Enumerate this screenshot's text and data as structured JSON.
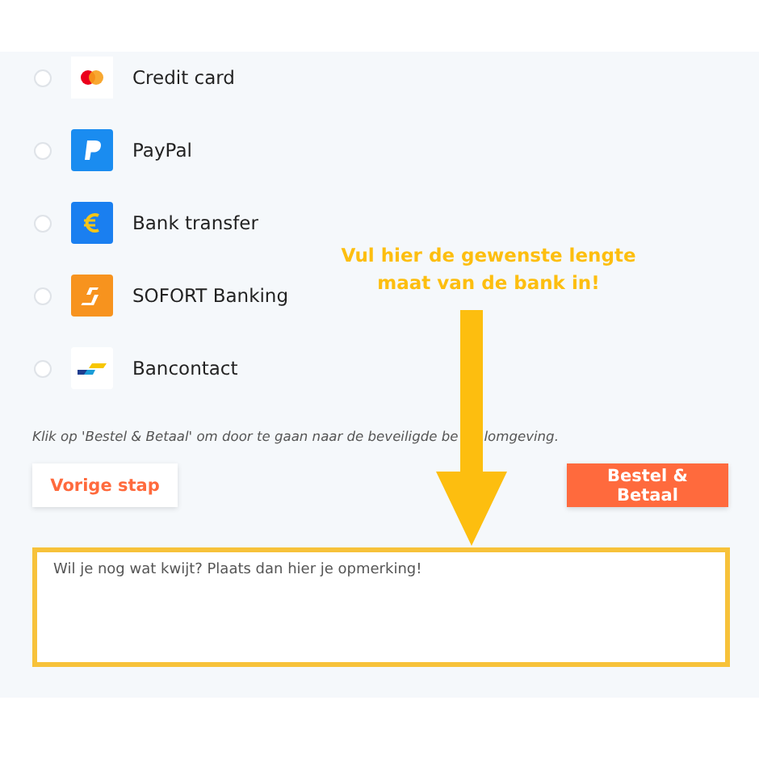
{
  "payment_methods": [
    {
      "kind": "mastercard",
      "label": "Credit card",
      "selected": false
    },
    {
      "kind": "paypal",
      "label": "PayPal",
      "selected": false
    },
    {
      "kind": "euro",
      "label": "Bank transfer",
      "selected": false
    },
    {
      "kind": "sofort",
      "label": "SOFORT Banking",
      "selected": false
    },
    {
      "kind": "bancontact",
      "label": "Bancontact",
      "selected": false
    }
  ],
  "notice_before_arrow": "Klik op 'Bestel & Betaal' om door te gaan naar de beveiligde be",
  "notice_after_arrow": "lomgeving.",
  "back_button": "Vorige stap",
  "order_button": "Bestel & Betaal",
  "remark_field": {
    "placeholder": "Wil je nog wat kwijt? Plaats dan hier je opmerking!"
  },
  "annotation": "Vul hier de gewenste lengte maat van de bank in!"
}
